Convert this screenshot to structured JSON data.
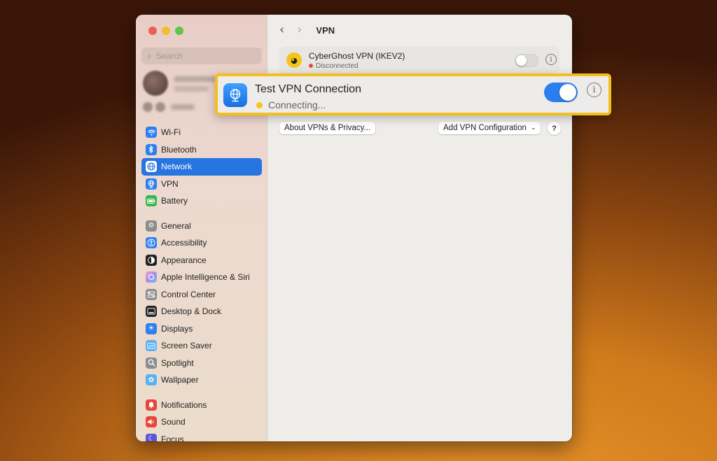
{
  "search": {
    "placeholder": "Search"
  },
  "sidebar": {
    "groups": [
      [
        {
          "label": "Wi-Fi",
          "icon": "wifi-icon"
        },
        {
          "label": "Bluetooth",
          "icon": "bluetooth-icon"
        },
        {
          "label": "Network",
          "icon": "network-globe-icon"
        },
        {
          "label": "VPN",
          "icon": "vpn-globe-icon"
        },
        {
          "label": "Battery",
          "icon": "battery-icon"
        }
      ],
      [
        {
          "label": "General",
          "icon": "gear-icon"
        },
        {
          "label": "Accessibility",
          "icon": "accessibility-icon"
        },
        {
          "label": "Appearance",
          "icon": "appearance-icon"
        },
        {
          "label": "Apple Intelligence & Siri",
          "icon": "siri-icon"
        },
        {
          "label": "Control Center",
          "icon": "control-center-icon"
        },
        {
          "label": "Desktop & Dock",
          "icon": "desktop-dock-icon"
        },
        {
          "label": "Displays",
          "icon": "displays-sun-icon"
        },
        {
          "label": "Screen Saver",
          "icon": "screen-saver-icon"
        },
        {
          "label": "Spotlight",
          "icon": "spotlight-magnifier-icon"
        },
        {
          "label": "Wallpaper",
          "icon": "wallpaper-flower-icon"
        }
      ],
      [
        {
          "label": "Notifications",
          "icon": "notifications-bell-icon"
        },
        {
          "label": "Sound",
          "icon": "sound-speaker-icon"
        },
        {
          "label": "Focus",
          "icon": "focus-moon-icon"
        }
      ]
    ],
    "active": "Network"
  },
  "toolbar": {
    "back": "‹",
    "forward": "›",
    "title": "VPN"
  },
  "vpn_list": {
    "item": {
      "name": "CyberGhost VPN (IKEV2)",
      "status": "Disconnected",
      "enabled": false
    }
  },
  "buttons": {
    "about": "About VPNs & Privacy...",
    "add": "Add VPN Configuration",
    "help": "?"
  },
  "callout": {
    "name": "Test VPN Connection",
    "status": "Connecting...",
    "enabled": true
  },
  "colors": {
    "accent": "#2775e0",
    "highlight_border": "#f2c01c",
    "connecting_dot": "#f5c518",
    "disconnected_dot": "#e54b3c"
  }
}
